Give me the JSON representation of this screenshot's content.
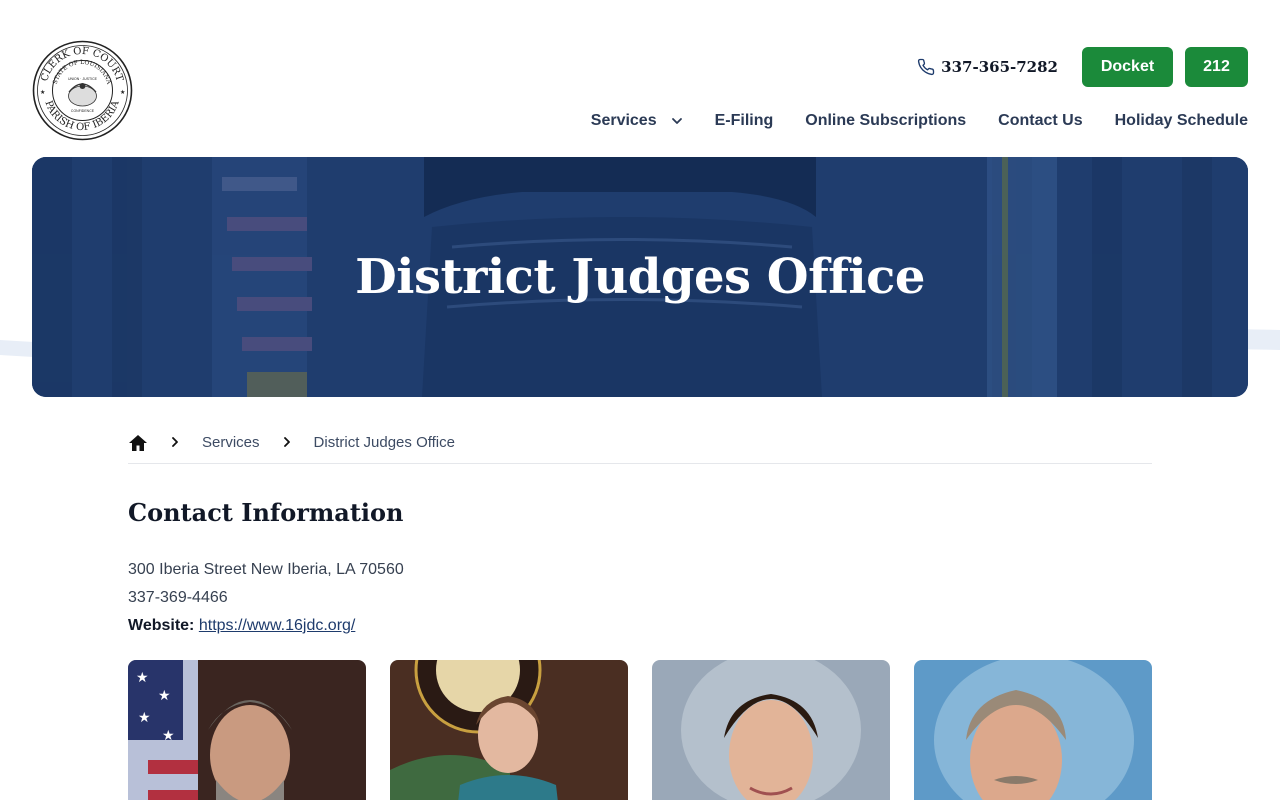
{
  "header": {
    "logo_text": [
      "CLERK OF COURT",
      "STATE OF LOUISIANA",
      "PARISH OF IBERIA",
      "UNION · JUSTICE",
      "CONFIDENCE"
    ],
    "phone": "337-365-7282",
    "buttons": {
      "docket": "Docket",
      "b212": "212"
    },
    "nav": [
      "Services",
      "E-Filing",
      "Online Subscriptions",
      "Contact Us",
      "Holiday Schedule"
    ]
  },
  "hero": {
    "title": "District Judges Office"
  },
  "breadcrumb": {
    "items": [
      "Services",
      "District Judges Office"
    ]
  },
  "contact": {
    "title": "Contact Information",
    "address": "300 Iberia Street New Iberia, LA 70560",
    "phone": "337-369-4466",
    "website_label": "Website:",
    "website_url": "https://www.16jdc.org/"
  },
  "colors": {
    "brand_green": "#1b8a3a",
    "navy": "#1e3b6c",
    "nav_text": "#2b3a55"
  },
  "icons": {
    "phone": "phone-icon",
    "chevron": "chevron-down-icon",
    "home": "home-icon",
    "separator": "chevron-right-icon"
  }
}
